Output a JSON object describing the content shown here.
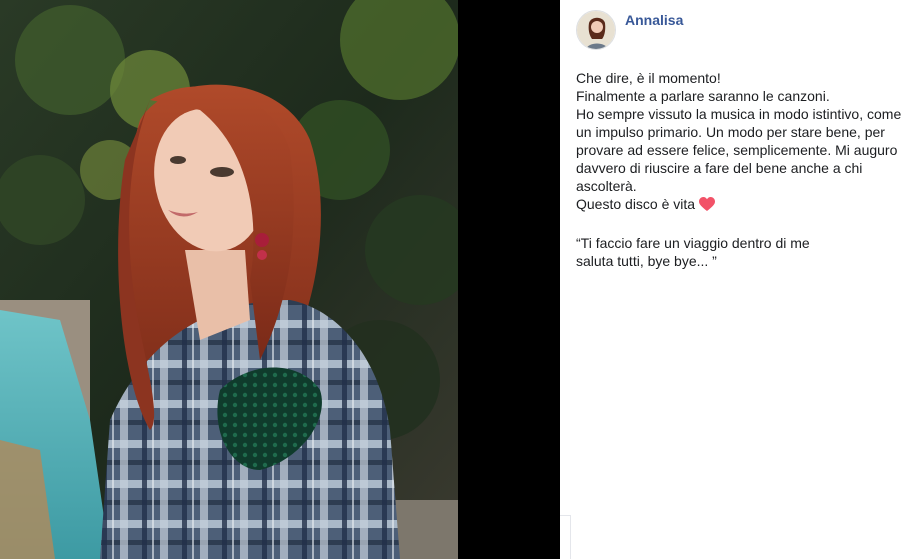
{
  "post": {
    "author": "Annalisa",
    "line1": "Che dire, è il momento!",
    "line2": "Finalmente a parlare saranno le canzoni.",
    "line3": "Ho sempre vissuto la musica in modo istintivo, come un impulso primario. Un modo per stare bene, per provare ad essere felice, semplicemente. Mi auguro davvero di riuscire a fare del bene anche a chi ascolterà.",
    "line4": "Questo disco è vita",
    "quote1": "“Ti faccio fare un viaggio dentro di me",
    "quote2": "saluta tutti, bye bye... ”",
    "heart_emoji": "heart-icon"
  },
  "colors": {
    "author_link": "#385898",
    "text": "#1c1e21",
    "heart": "#f25268",
    "media_bg": "#000000"
  }
}
